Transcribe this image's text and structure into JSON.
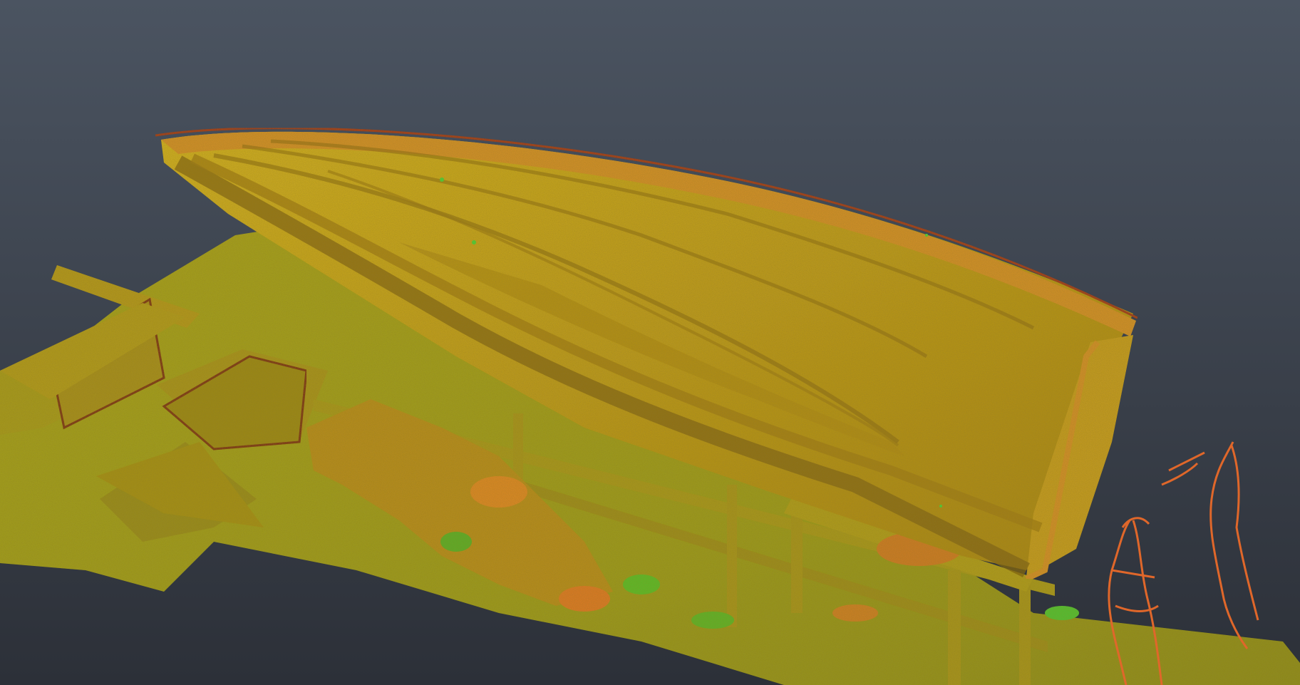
{
  "viewer": {
    "background_top": "#4b5461",
    "background_bottom": "#2c3038"
  },
  "palette": {
    "hull_light": "#c9a81c",
    "hull_mid": "#b8941a",
    "hull_dark": "#7d5f12",
    "rim_orange": "#d98a2a",
    "edge_red": "#a0241c",
    "ground_yellow": "#b4a21e",
    "ground_green": "#8fa01e",
    "highlight_green": "#38d43a",
    "person_orange": "#e0672a"
  }
}
